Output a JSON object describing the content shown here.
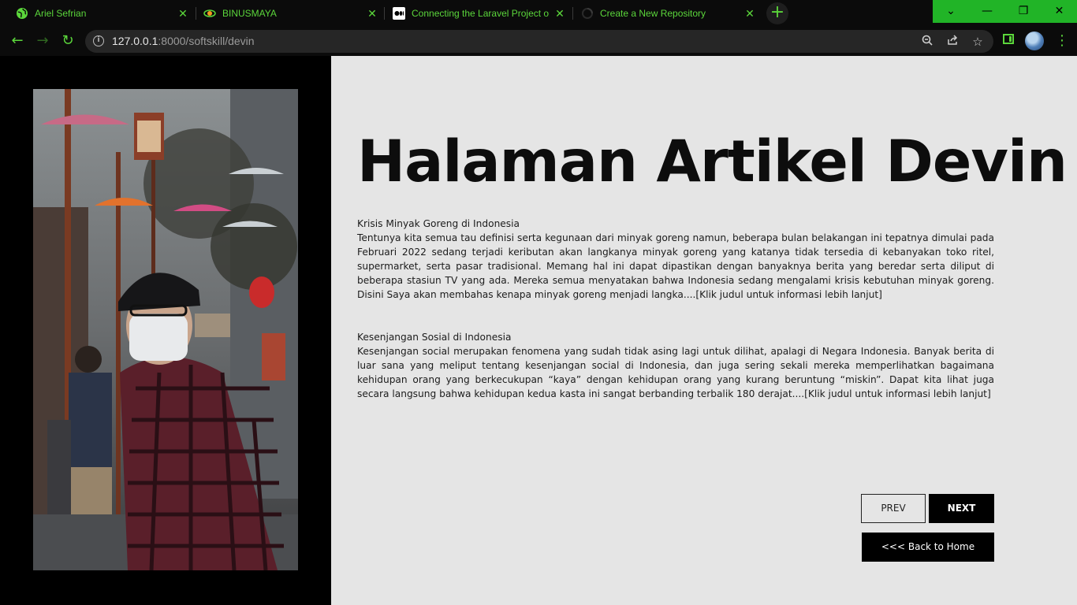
{
  "browser": {
    "tabs": [
      {
        "title": "Ariel Sefrian",
        "icon": "globe-icon"
      },
      {
        "title": "BINUSMAYA",
        "icon": "binusmaya-logo-icon"
      },
      {
        "title": "Connecting the Laravel Project on",
        "icon": "medium-logo-icon"
      },
      {
        "title": "Create a New Repository",
        "icon": "loading-spinner-icon"
      }
    ],
    "tab_close": "✕",
    "new_tab": "+",
    "window_controls": {
      "collapse": "⌄",
      "minimize": "—",
      "restore": "❐",
      "close": "✕"
    },
    "address": {
      "host": "127.0.0.1",
      "rest": ":8000/softskill/devin"
    },
    "accent_color": "#5bd63b"
  },
  "page": {
    "title": "Halaman Artikel Devin",
    "articles": [
      {
        "title": "Krisis Minyak Goreng di Indonesia",
        "body": "Tentunya kita semua tau definisi serta kegunaan dari minyak goreng namun, beberapa bulan belakangan ini tepatnya dimulai pada Februari 2022 sedang terjadi keributan akan langkanya minyak goreng yang katanya tidak tersedia di kebanyakan toko ritel, supermarket, serta pasar tradisional. Memang hal ini dapat dipastikan dengan banyaknya berita yang beredar serta diliput di beberapa stasiun TV yang ada. Mereka semua menyatakan bahwa Indonesia sedang mengalami krisis kebutuhan minyak goreng. Disini Saya akan membahas kenapa minyak goreng menjadi langka....[Klik judul untuk informasi lebih lanjut]"
      },
      {
        "title": "Kesenjangan Sosial di Indonesia",
        "body": "Kesenjangan social merupakan fenomena yang sudah tidak asing lagi untuk dilihat, apalagi di Negara Indonesia. Banyak berita di luar sana yang meliput tentang kesenjangan social di Indonesia, dan juga sering sekali mereka memperlihatkan bagaimana kehidupan orang yang berkecukupan “kaya” dengan kehidupan orang yang kurang beruntung “miskin”. Dapat kita lihat juga secara langsung bahwa kehidupan kedua kasta ini sangat berbanding terbalik 180 derajat....[Klik judul untuk informasi lebih lanjut]"
      }
    ],
    "prev_label": "PREV",
    "next_label": "NEXT",
    "home_label": "<<< Back to Home"
  }
}
